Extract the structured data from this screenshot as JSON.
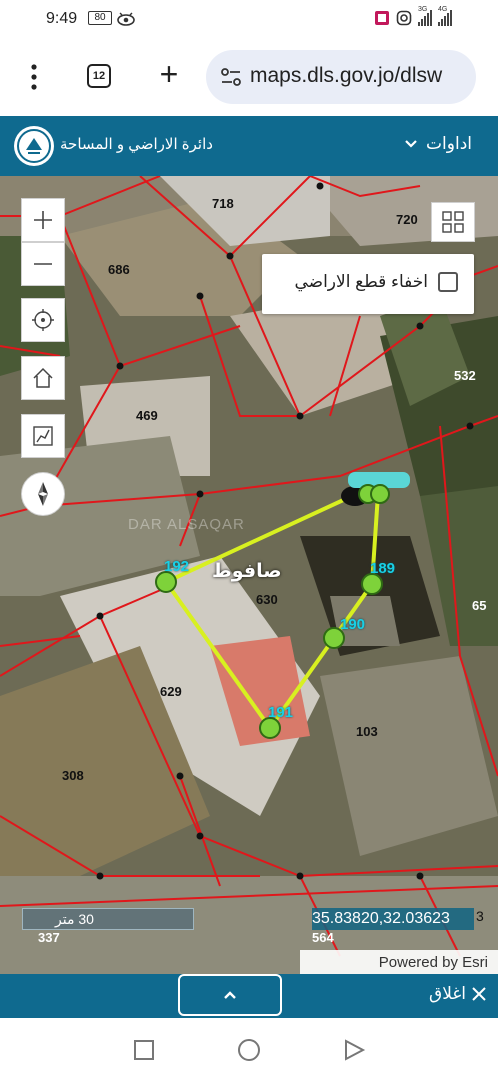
{
  "status": {
    "time": "9:49",
    "battery": "80",
    "net1": "3G",
    "net2": "4G"
  },
  "browser": {
    "tab_count": "12",
    "url": "maps.dls.gov.jo/dlsw"
  },
  "header": {
    "title": "دائرة الاراضي و المساحة",
    "tools_label": "اداوات"
  },
  "layer_toggle": {
    "label": "اخفاء قطع الاراضي",
    "checked": false
  },
  "map": {
    "parcels": [
      "718",
      "720",
      "686",
      "532",
      "469",
      "630",
      "65",
      "629",
      "103",
      "308",
      "337",
      "564"
    ],
    "points": [
      "192",
      "189",
      "190",
      "191"
    ],
    "town": "صافوط",
    "watermark": "DAR ALSAQAR",
    "scale": "30 متر",
    "coordinates": "35.83820,32.03623",
    "coord_tail": "3",
    "attribution": "Powered by Esri"
  },
  "controls": [
    "zoom-in",
    "zoom-out",
    "locate",
    "home",
    "measure",
    "compass"
  ],
  "bottom": {
    "close_label": "اغلاق"
  },
  "colors": {
    "header": "#0f6a8f",
    "parcel_line": "#e0171b",
    "polygon_line": "#d8f020",
    "point_fill": "#7ed23a",
    "point_label": "#18d0e6"
  }
}
